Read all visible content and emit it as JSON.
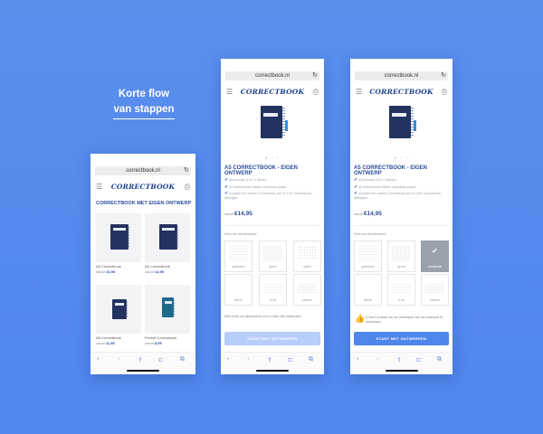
{
  "headline": {
    "line1": "Korte flow",
    "line2": "van stappen"
  },
  "url": "correctbook.nl",
  "logo": "CORRECTBOOK",
  "icons": {
    "reload": "reload-icon",
    "menu": "hamburger-icon",
    "cart": "bag-icon",
    "check": "check-icon",
    "thumbs": "thumbs-up-icon"
  },
  "colors": {
    "accent": "#4f86ec",
    "brand": "#2c4e9c",
    "notebook": "#23325e",
    "teal": "#1d6a8a"
  },
  "phone1": {
    "section_title": "CORRECTBOOK MET EIGEN ONTWERP",
    "products": [
      {
        "name": "A5 Correctbook",
        "price_prefix": "vanaf",
        "price": "10,95"
      },
      {
        "name": "A5 Correctbook",
        "price_prefix": "vanaf",
        "price": "14,95"
      },
      {
        "name": "A6 Correctbook",
        "price_prefix": "vanaf",
        "price": "11,95"
      },
      {
        "name": "Pocket Correctbook",
        "price_prefix": "vanaf",
        "price": "8,95"
      }
    ]
  },
  "product": {
    "title": "A5 CORRECTBOOK - EIGEN ONTWERP",
    "features": [
      "A5 formaat (210 x 148mm)",
      "40 herbruikbare bladen uitwisbaar papier",
      "Inclusief een zwarte Correctbook pen en 10% Correctbook-tijdslagen"
    ],
    "price_prefix": "vanaf",
    "price": "€14,95",
    "choose_label": "Kies uw binnenwerk",
    "interiors": [
      "gelinieerd",
      "geruit",
      "dotted",
      "blanco",
      "to-do",
      "planner"
    ],
    "interiors_phone3": [
      "gelinieerd",
      "geruit",
      "combinatie",
      "blanco",
      "to-do",
      "planner"
    ],
    "helper_phone2": "Kies eerst uw binnenwerk voor u start met ontwerpen",
    "helper_phone3": "U bent nu klaar om de ontwerpen van uw notebook te ontwerpen",
    "cta": "START MET ONTWERPEN"
  },
  "browser": {
    "back": "‹",
    "forward": "›",
    "share": "⇪",
    "bookmarks": "⊏",
    "tabs": "⧉"
  }
}
